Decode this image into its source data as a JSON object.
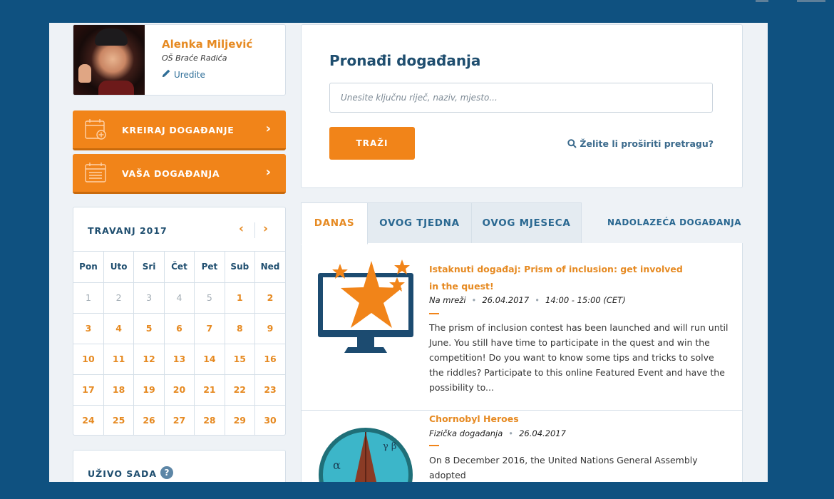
{
  "colors": {
    "background": "#0f5180",
    "accent": "#f18419",
    "heading": "#1f4e6f",
    "link": "#2f6f99"
  },
  "profile": {
    "name": "Alenka Miljević",
    "school": "OŠ Braće Radića",
    "edit_label": "Uredite"
  },
  "actions": {
    "create_label": "KREIRAJ DOGAĐANJE",
    "my_events_label": "VAŠA DOGAĐANJA"
  },
  "calendar": {
    "title": "TRAVANJ 2017",
    "weekdays": [
      "Pon",
      "Uto",
      "Sri",
      "Čet",
      "Pet",
      "Sub",
      "Ned"
    ],
    "weeks": [
      [
        "1",
        "2",
        "3",
        "4",
        "5",
        "1",
        "2"
      ],
      [
        "3",
        "4",
        "5",
        "6",
        "7",
        "8",
        "9"
      ],
      [
        "10",
        "11",
        "12",
        "13",
        "14",
        "15",
        "16"
      ],
      [
        "17",
        "18",
        "19",
        "20",
        "21",
        "22",
        "23"
      ],
      [
        "24",
        "25",
        "26",
        "27",
        "28",
        "29",
        "30"
      ]
    ],
    "prev_icon": "chevron-left-icon",
    "next_icon": "chevron-right-icon"
  },
  "live": {
    "title": "UŽIVO SADA",
    "help_icon": "question-icon"
  },
  "search": {
    "title": "Pronađi događanja",
    "placeholder": "Unesite ključnu riječ, naziv, mjesto...",
    "button_label": "TRAŽI",
    "advanced_label": "Želite li proširiti pretragu?"
  },
  "tabs": {
    "items": [
      {
        "label": "DANAS"
      },
      {
        "label": "OVOG TJEDNA"
      },
      {
        "label": "OVOG MJESECA"
      }
    ],
    "upcoming_label": "NADOLAZEĆA DOGAĐANJA"
  },
  "events": [
    {
      "title": "Istaknuti događaj: Prism of inclusion: get involved in the quest!",
      "location": "Na mreži",
      "date": "26.04.2017",
      "time": "14:00 - 15:00 (CET)",
      "description": "The prism of inclusion contest has been launched and will run until June. You still have time to participate in the quest and win the competition! Do you want to know some tips and tricks to solve the riddles? Participate to this online Featured Event and have the possibility to...",
      "image": "star-monitor-icon"
    },
    {
      "title": "Chornobyl Heroes",
      "location": "Fizička događanja",
      "date": "26.04.2017",
      "description": "On 8 December 2016, the United Nations General Assembly adopted",
      "image": "medal-icon"
    }
  ]
}
